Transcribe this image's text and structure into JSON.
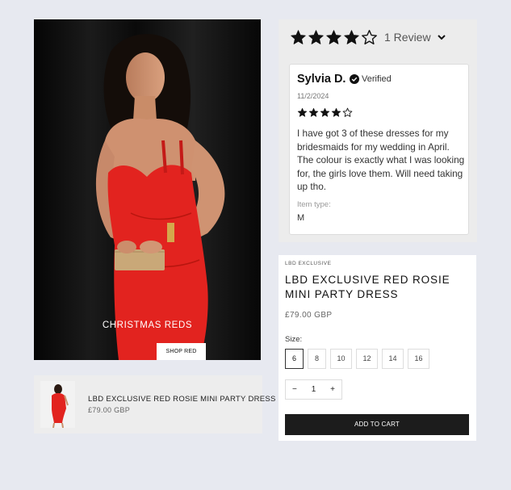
{
  "hero": {
    "title": "CHRISTMAS REDS",
    "button_label": "SHOP RED"
  },
  "mini_card": {
    "name": "LBD EXCLUSIVE RED ROSIE MINI PARTY DRESS",
    "price": "£79.00 GBP"
  },
  "reviews": {
    "rating": 4,
    "max_rating": 5,
    "count_label": "1 Review",
    "items": [
      {
        "author": "Sylvia D.",
        "verified_label": "Verified",
        "date": "11/2/2024",
        "rating": 4,
        "body": "I have got 3 of these dresses for my bridesmaids for my wedding in April. The colour is exactly what I was looking for, the girls love them. Will need taking up tho.",
        "item_type_label": "Item type:",
        "item_type_value": "M"
      }
    ]
  },
  "product": {
    "brand": "LBD EXCLUSIVE",
    "title": "LBD EXCLUSIVE RED ROSIE MINI PARTY DRESS",
    "price": "£79.00 GBP",
    "size_label": "Size:",
    "sizes": [
      "6",
      "8",
      "10",
      "12",
      "14",
      "16"
    ],
    "selected_size": "6",
    "quantity": "1",
    "qty_minus": "−",
    "qty_plus": "+",
    "add_to_cart_label": "ADD TO CART"
  },
  "colors": {
    "background": "#e7e9f0",
    "dress_red": "#e2231f",
    "button_dark": "#1c1c1c",
    "review_panel": "#ececec"
  },
  "icons": [
    "star-icon",
    "chevron-down-icon",
    "verified-check-icon"
  ]
}
